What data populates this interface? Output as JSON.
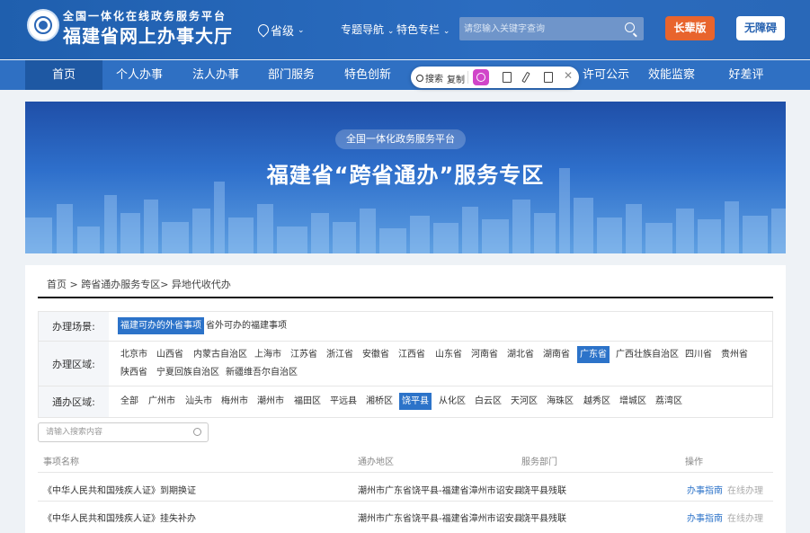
{
  "header": {
    "logo_sub": "全国一体化在线政务服务平台",
    "logo_title": "福建省网上办事大厅",
    "region": "省级",
    "topic_nav": "专题导航",
    "special": "特色专栏",
    "search_placeholder": "请您输入关键字查询",
    "elder_btn": "长辈版",
    "access_btn": "无障碍"
  },
  "navbar": [
    "首页",
    "个人办事",
    "法人办事",
    "部门服务",
    "特色创新",
    "许可公示",
    "效能监察",
    "好差评"
  ],
  "float_toolbar": {
    "search": "搜索",
    "copy": "复制"
  },
  "banner": {
    "pill": "全国一体化政务服务平台",
    "title": "福建省“跨省通办”服务专区"
  },
  "breadcrumb": "首页 > 跨省通办服务专区> 异地代收代办",
  "filters": {
    "scene_label": "办理场景:",
    "scene_options": [
      "福建可办的外省事项",
      "省外可办的福建事项"
    ],
    "area_label": "办理区域:",
    "area_options": [
      "北京市",
      "山西省",
      "内蒙古自治区",
      "上海市",
      "江苏省",
      "浙江省",
      "安徽省",
      "江西省",
      "山东省",
      "河南省",
      "湖北省",
      "湖南省",
      "广东省",
      "广西壮族自治区",
      "四川省",
      "贵州省",
      "陕西省",
      "宁夏回族自治区",
      "新疆维吾尔自治区"
    ],
    "tong_label": "通办区域:",
    "tong_options": [
      "全部",
      "广州市",
      "汕头市",
      "梅州市",
      "潮州市",
      "福田区",
      "平远县",
      "湘桥区",
      "饶平县",
      "从化区",
      "白云区",
      "天河区",
      "海珠区",
      "越秀区",
      "增城区",
      "荔湾区"
    ]
  },
  "list_search_placeholder": "请输入搜索内容",
  "table": {
    "headers": [
      "事项名称",
      "通办地区",
      "服务部门",
      "操作"
    ],
    "rows": [
      {
        "name": "《中华人民共和国残疾人证》到期换证",
        "region": "潮州市广东省饶平县-福建省漳州市诏安县",
        "dept": "饶平县残联",
        "guide": "办事指南",
        "online": "在线办理"
      },
      {
        "name": "《中华人民共和国残疾人证》挂失补办",
        "region": "潮州市广东省饶平县-福建省漳州市诏安县",
        "dept": "饶平县残联",
        "guide": "办事指南",
        "online": "在线办理"
      }
    ]
  }
}
